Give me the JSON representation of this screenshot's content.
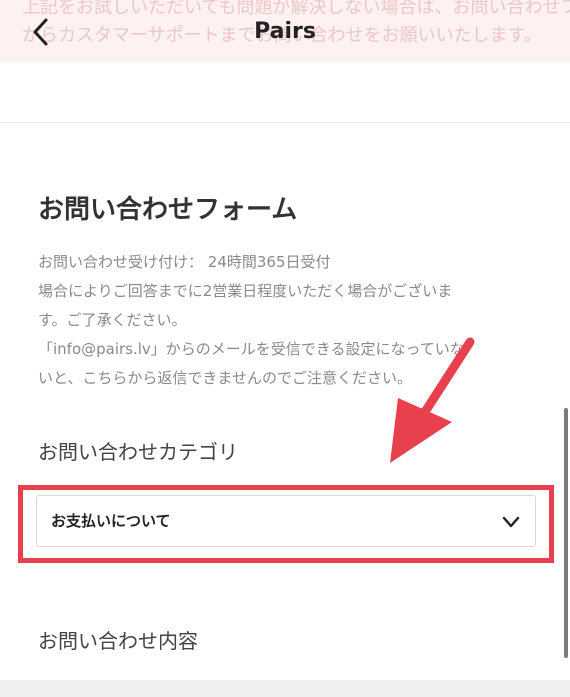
{
  "banner": {
    "lines": [
      "上記をお試しいただいても問題が解決しない場合は、お問い合わせフォーム",
      "からカスタマーサポートまでお問い合わせをお願いいたします。"
    ]
  },
  "nav": {
    "title": "Pairs",
    "back_icon": "chevron-left-icon"
  },
  "form": {
    "title": "お問い合わせフォーム",
    "notice_lines": [
      "お問い合わせ受け付け： 24時間365日受付",
      "場合によりご回答までに2営業日程度いただく場合がございま",
      "す。ご了承ください。",
      "「info@pairs.lv」からのメールを受信できる設定になっていな",
      "いと、こちらから返信できませんのでご注意ください。"
    ],
    "category_label": "お問い合わせカテゴリ",
    "category_selected": "お支払いについて",
    "content_label": "お問い合わせ内容"
  },
  "colors": {
    "highlight": "#e8404d",
    "arrow": "#e8404d",
    "banner_bg": "#fdf1f1"
  }
}
